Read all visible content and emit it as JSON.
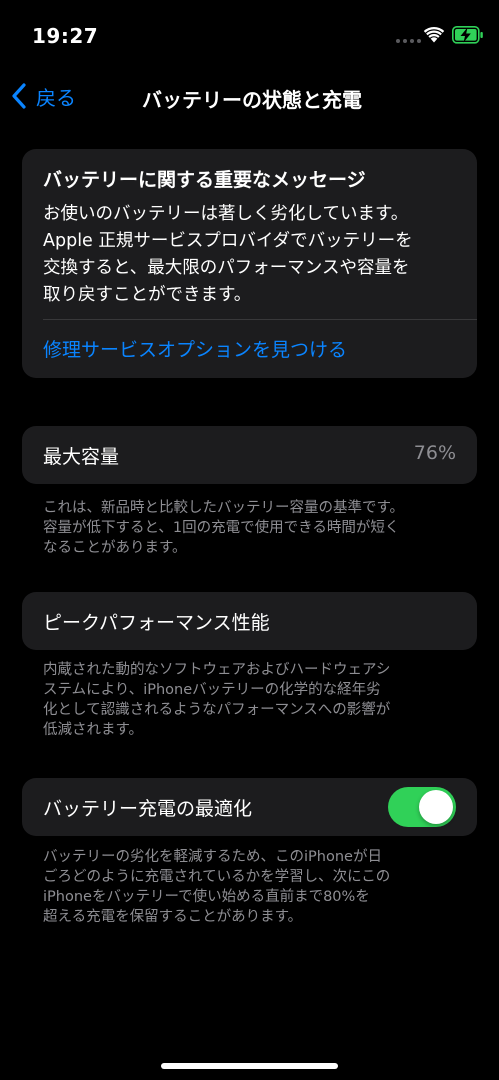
{
  "status_bar": {
    "time": "19:27",
    "wifi_icon": "wifi-icon",
    "battery_icon": "battery-charging-icon",
    "battery_color": "#30d158"
  },
  "nav": {
    "back_label": "戻る",
    "title": "バッテリーの状態と充電",
    "accent": "#0a84ff"
  },
  "message": {
    "title": "バッテリーに関する重要なメッセージ",
    "body": "お使いのバッテリーは著しく劣化しています。\nApple 正規サービスプロバイダでバッテリーを\n交換すると、最大限のパフォーマンスや容量を\n取り戻すことができます。",
    "link": "修理サービスオプションを見つける"
  },
  "capacity": {
    "label": "最大容量",
    "value": "76%",
    "footnote": "これは、新品時と比較したバッテリー容量の基準です。\n容量が低下すると、1回の充電で使用できる時間が短く\nなることがあります。"
  },
  "peak": {
    "label": "ピークパフォーマンス性能",
    "footnote": "内蔵された動的なソフトウェアおよびハードウェアシ\nステムにより、iPhoneバッテリーの化学的な経年劣\n化として認識されるようなパフォーマンスへの影響が\n低減されます。"
  },
  "optimized": {
    "label": "バッテリー充電の最適化",
    "enabled": true,
    "toggle_color": "#30d158",
    "footnote": "バッテリーの劣化を軽減するため、このiPhoneが日\nごろどのように充電されているかを学習し、次にこの\niPhoneをバッテリーで使い始める直前まで80%を\n超える充電を保留することがあります。"
  }
}
